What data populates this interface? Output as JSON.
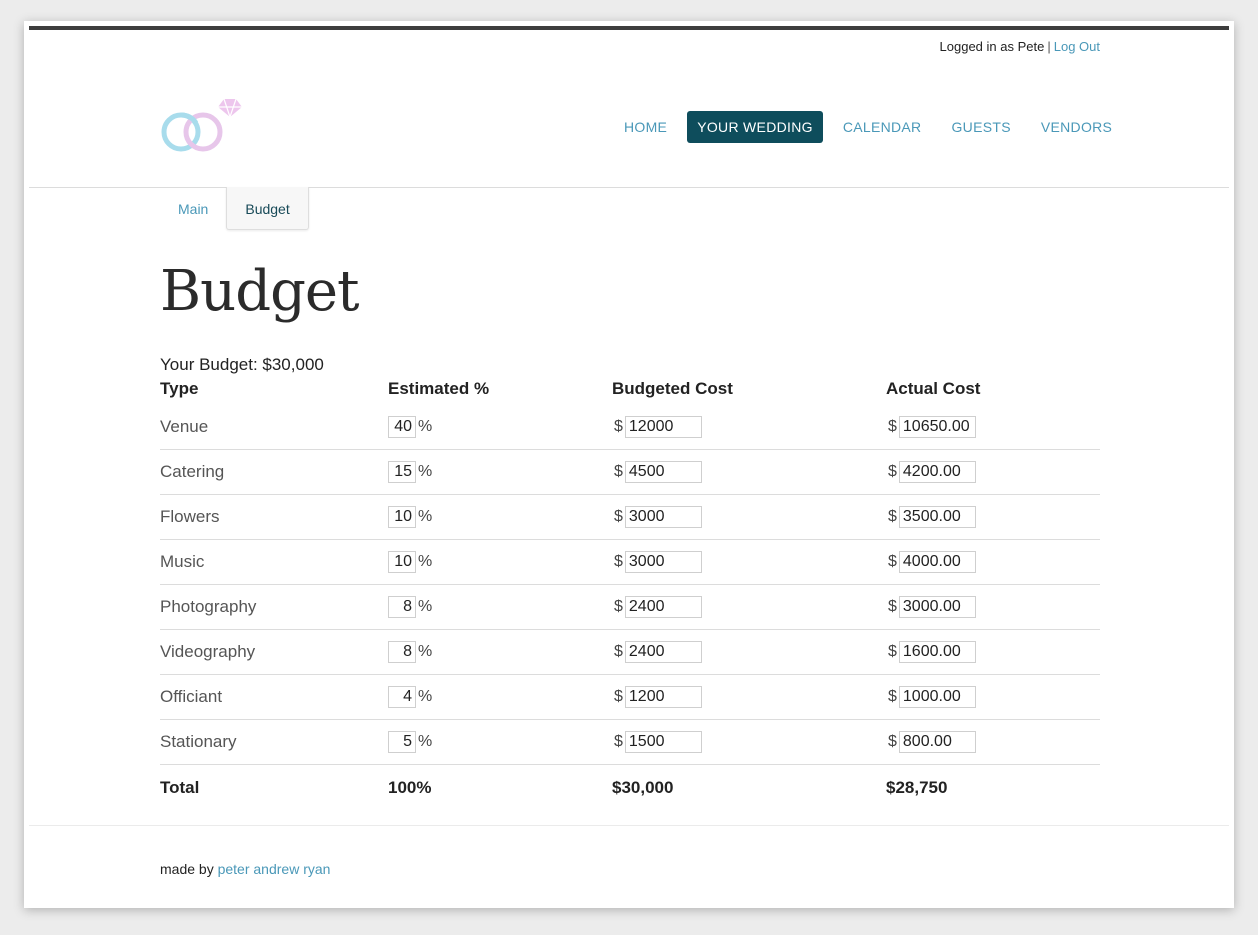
{
  "userbar": {
    "logged_in_text": "Logged in as Pete",
    "separator": "|",
    "logout_label": "Log Out"
  },
  "nav": {
    "items": [
      "HOME",
      "YOUR WEDDING",
      "CALENDAR",
      "GUESTS",
      "VENDORS"
    ],
    "active": "YOUR WEDDING"
  },
  "subtabs": {
    "main_label": "Main",
    "budget_label": "Budget"
  },
  "page": {
    "title": "Budget",
    "budget_line": "Your Budget: $30,000"
  },
  "table": {
    "headers": {
      "type": "Type",
      "estimated": "Estimated %",
      "budgeted": "Budgeted Cost",
      "actual": "Actual Cost"
    },
    "rows": [
      {
        "type": "Venue",
        "pct": "40",
        "budgeted": "12000",
        "actual": "10650.00"
      },
      {
        "type": "Catering",
        "pct": "15",
        "budgeted": "4500",
        "actual": "4200.00"
      },
      {
        "type": "Flowers",
        "pct": "10",
        "budgeted": "3000",
        "actual": "3500.00"
      },
      {
        "type": "Music",
        "pct": "10",
        "budgeted": "3000",
        "actual": "4000.00"
      },
      {
        "type": "Photography",
        "pct": "8",
        "budgeted": "2400",
        "actual": "3000.00"
      },
      {
        "type": "Videography",
        "pct": "8",
        "budgeted": "2400",
        "actual": "1600.00"
      },
      {
        "type": "Officiant",
        "pct": "4",
        "budgeted": "1200",
        "actual": "1000.00"
      },
      {
        "type": "Stationary",
        "pct": "5",
        "budgeted": "1500",
        "actual": "800.00"
      }
    ],
    "percent_symbol": "%",
    "currency_symbol": "$",
    "total": {
      "label": "Total",
      "pct": "100%",
      "budgeted": "$30,000",
      "actual": "$28,750"
    }
  },
  "footer": {
    "prefix": "made by",
    "author_link": "peter andrew ryan"
  },
  "colors": {
    "accent": "#4a98b8",
    "nav_active_bg": "#0e4d5c",
    "topbar": "#3d3d3d"
  },
  "icons": {
    "logo": "wedding-rings-icon"
  }
}
